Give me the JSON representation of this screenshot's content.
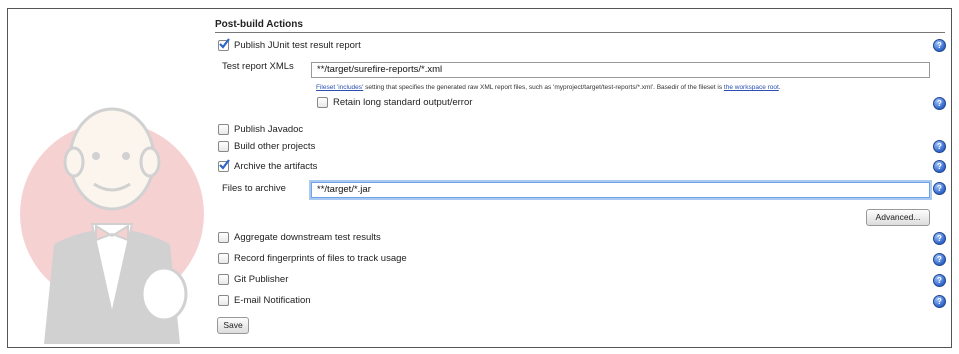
{
  "section": {
    "title": "Post-build Actions"
  },
  "junit": {
    "label": "Publish JUnit test result report",
    "checked": true,
    "xml_label": "Test report XMLs",
    "xml_value": "**/target/surefire-reports/*.xml",
    "hint_link1": "Fileset 'includes'",
    "hint_mid": " setting that specifies the generated raw XML report files, such as 'myproject/target/test-reports/*.xml'. Basedir of the fileset is ",
    "hint_link2": "the workspace root",
    "hint_end": ".",
    "retain_label": "Retain long standard output/error"
  },
  "options_a": [
    {
      "label": "Publish Javadoc",
      "checked": false
    },
    {
      "label": "Build other projects",
      "checked": false
    },
    {
      "label": "Archive the artifacts",
      "checked": true
    }
  ],
  "archive": {
    "files_label": "Files to archive",
    "files_value": "**/target/*.jar",
    "advanced_label": "Advanced..."
  },
  "options_b": [
    {
      "label": "Aggregate downstream test results",
      "checked": false
    },
    {
      "label": "Record fingerprints of files to track usage",
      "checked": false
    },
    {
      "label": "Git Publisher",
      "checked": false
    },
    {
      "label": "E-mail Notification",
      "checked": false
    }
  ],
  "save_label": "Save",
  "help_glyph": "?",
  "icons": {
    "help": "help-icon",
    "mascot": "jenkins-butler-logo"
  },
  "colors": {
    "help_blue": "#2f64c9",
    "link": "#2a4fb0",
    "focus": "#6fa3e6"
  }
}
